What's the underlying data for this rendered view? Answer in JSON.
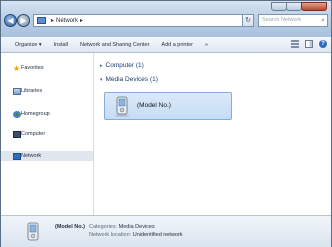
{
  "address": {
    "crumbs": [
      "Network"
    ],
    "search_placeholder": "Search Network"
  },
  "commands": [
    "Organize",
    "Install",
    "Network and Sharing Center",
    "Add a printer"
  ],
  "nav": [
    {
      "label": "Favorites",
      "icon": "star-icon"
    },
    {
      "label": "Libraries",
      "icon": "libraries-icon"
    },
    {
      "label": "Homegroup",
      "icon": "homegroup-icon"
    },
    {
      "label": "Computer",
      "icon": "computer-icon"
    },
    {
      "label": "Network",
      "icon": "network-icon",
      "selected": true
    }
  ],
  "groups": {
    "computer": "Computer (1)",
    "media": "Media Devices (1)"
  },
  "device": {
    "name": "(Model No.)"
  },
  "details": {
    "name": "(Model No.)",
    "categories_label": "Categories:",
    "categories_value": "Media Devices",
    "location_label": "Network location:",
    "location_value": "Unidentified network"
  },
  "colors": {
    "selected_tile": "#c5dcf5",
    "titlebar": "#bcd0e6"
  }
}
